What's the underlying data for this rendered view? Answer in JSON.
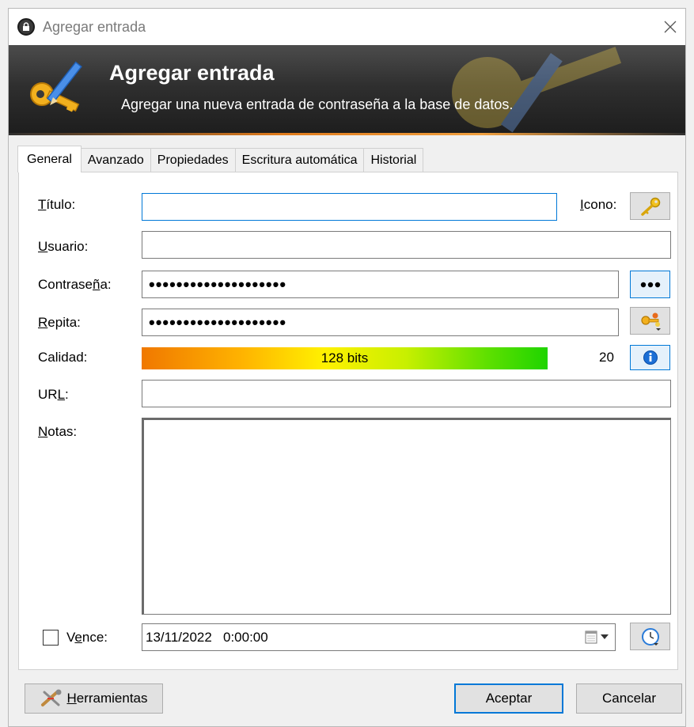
{
  "window": {
    "title": "Agregar entrada"
  },
  "banner": {
    "title": "Agregar entrada",
    "subtitle": "Agregar una nueva entrada de contraseña a la base de datos."
  },
  "tabs": [
    {
      "label": "General",
      "active": true
    },
    {
      "label": "Avanzado",
      "active": false
    },
    {
      "label": "Propiedades",
      "active": false
    },
    {
      "label": "Escritura automática",
      "active": false
    },
    {
      "label": "Historial",
      "active": false
    }
  ],
  "form": {
    "title_label_u": "T",
    "title_label_rest": "ítulo:",
    "title_value": "",
    "icon_label_u": "I",
    "icon_label_rest": "cono:",
    "user_label_u": "U",
    "user_label_rest": "suario:",
    "user_value": "",
    "password_label_a": "Contrase",
    "password_label_u": "ñ",
    "password_label_b": "a:",
    "password_value": "••••••••••••••••••••",
    "repeat_label_u": "R",
    "repeat_label_rest": "epita:",
    "repeat_value": "••••••••••••••••••••",
    "quality_label": "Calidad:",
    "quality_bits": "128 bits",
    "quality_fill_percent": 100,
    "quality_count": "20",
    "url_label_a": "UR",
    "url_label_u": "L",
    "url_label_b": ":",
    "url_value": "",
    "notes_label_u": "N",
    "notes_label_rest": "otas:",
    "notes_value": "",
    "expires_checked": false,
    "expires_label_a": "V",
    "expires_label_u": "e",
    "expires_label_b": "nce:",
    "expires_value": "13/11/2022   0:00:00"
  },
  "footer": {
    "tools_label_u": "H",
    "tools_label_rest": "erramientas",
    "ok_label": "Aceptar",
    "cancel_label": "Cancelar"
  },
  "colors": {
    "accent": "#0078d7",
    "banner_dark": "#1d1d1d",
    "banner_line": "#e07b1c"
  },
  "icons": {
    "app": "lock-icon",
    "close": "close-icon",
    "banner": "key-pencil-icon",
    "entry_icon": "key-icon",
    "show_password": "dots-icon",
    "generate_password": "key-generator-icon",
    "quality_info": "info-icon",
    "calendar": "calendar-icon",
    "expiry_presets": "clock-icon",
    "tools": "tools-icon"
  }
}
